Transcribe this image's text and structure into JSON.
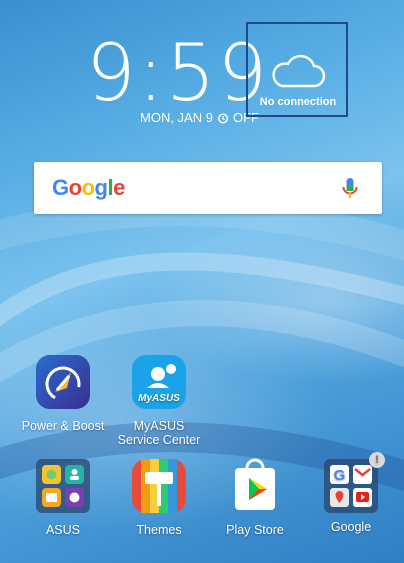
{
  "clock": {
    "hour": "9",
    "minute": "59"
  },
  "date": {
    "text": "MON, JAN 9",
    "alarm_status": "OFF"
  },
  "weather": {
    "status": "No connection",
    "icon": "cloud-icon"
  },
  "search": {
    "logo": "Google",
    "icon": "mic-icon"
  },
  "apps": [
    {
      "label": "Power & Boost",
      "icon": "power-boost-icon"
    },
    {
      "label": "MyASUS Service Center",
      "icon": "myasus-icon",
      "icon_text": "MyASUS"
    }
  ],
  "dock": [
    {
      "label": "ASUS",
      "icon": "asus-folder-icon"
    },
    {
      "label": "Themes",
      "icon": "themes-icon"
    },
    {
      "label": "Play Store",
      "icon": "play-store-icon"
    },
    {
      "label": "Google",
      "icon": "google-folder-icon",
      "badge": "!"
    }
  ],
  "colors": {
    "google_blue": "#4285F4",
    "google_red": "#EA4335",
    "google_yellow": "#FBBC05",
    "google_green": "#34A853",
    "weather_border": "#1e4b8c"
  }
}
